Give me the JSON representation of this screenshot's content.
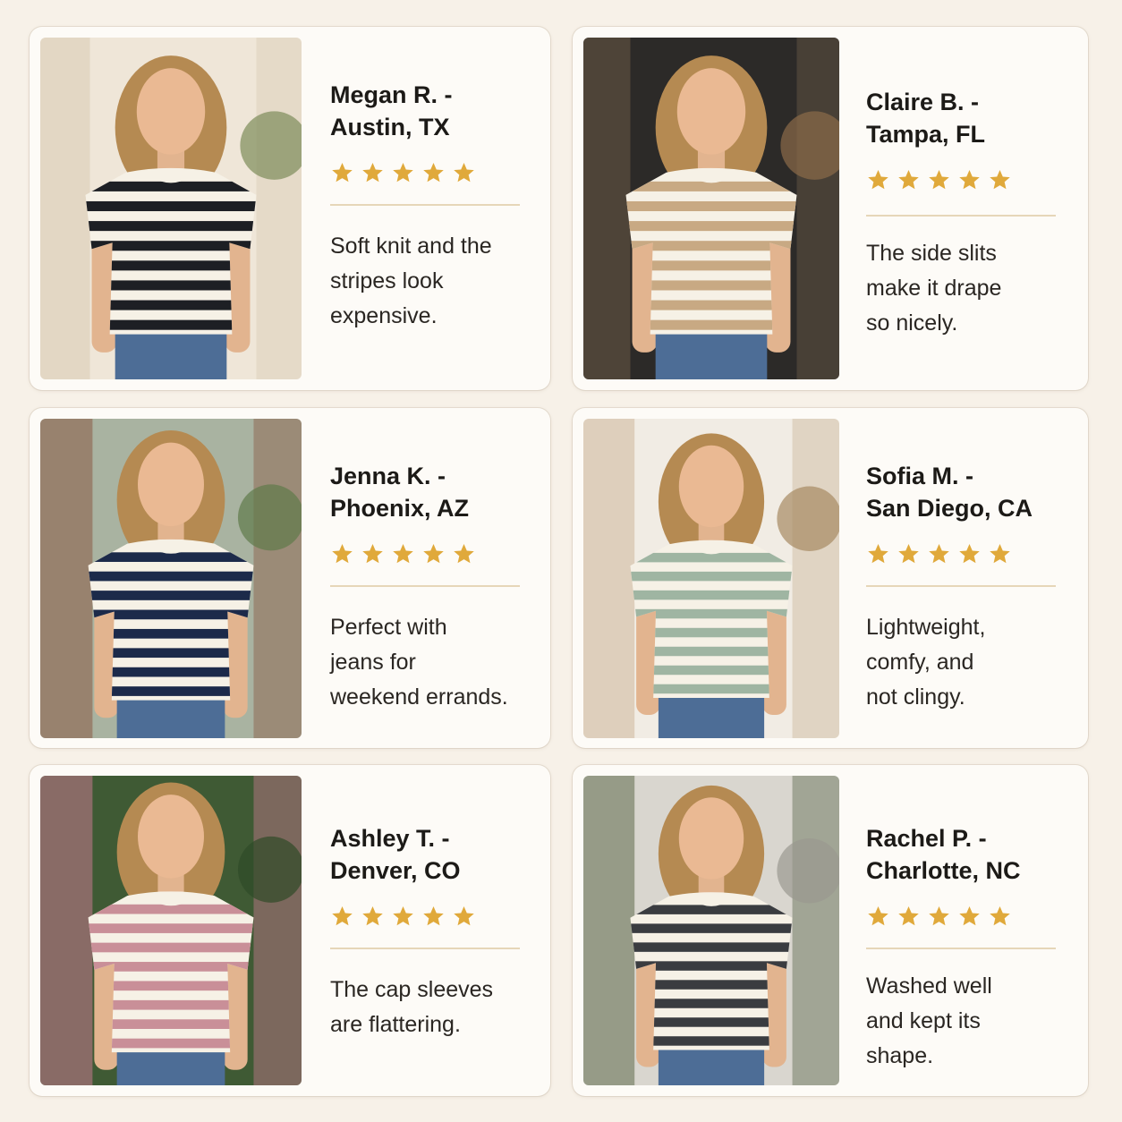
{
  "colors": {
    "page_bg": "#f7f1e8",
    "card_bg": "#fdfbf7",
    "star": "#e0a93b",
    "divider": "#e6d6b8"
  },
  "reviews": [
    {
      "name": "Megan R. -\nAustin, TX",
      "rating": 5,
      "text": "Soft knit and the\nstripes look\nexpensive.",
      "stripe_color": "#1d1f24",
      "setting": "indoor-cream"
    },
    {
      "name": "Claire B. -\nTampa, FL",
      "rating": 5,
      "text": "The side slits\nmake it drape\nso nicely.",
      "stripe_color": "#c8a983",
      "setting": "cafe-dark"
    },
    {
      "name": "Jenna K. -\nPhoenix, AZ",
      "rating": 5,
      "text": "Perfect with\njeans for\nweekend errands.",
      "stripe_color": "#1c2a4a",
      "setting": "street"
    },
    {
      "name": "Sofia M. -\nSan Diego, CA",
      "rating": 5,
      "text": "Lightweight,\ncomfy, and\nnot clingy.",
      "stripe_color": "#9fb5a2",
      "setting": "kitchen"
    },
    {
      "name": "Ashley T. -\nDenver, CO",
      "rating": 5,
      "text": "The cap sleeves\nare flattering.",
      "stripe_color": "#c98f98",
      "setting": "garden"
    },
    {
      "name": "Rachel P. -\nCharlotte, NC",
      "rating": 5,
      "text": "Washed well\nand kept its\nshape.",
      "stripe_color": "#3a3c40",
      "setting": "porch"
    }
  ]
}
